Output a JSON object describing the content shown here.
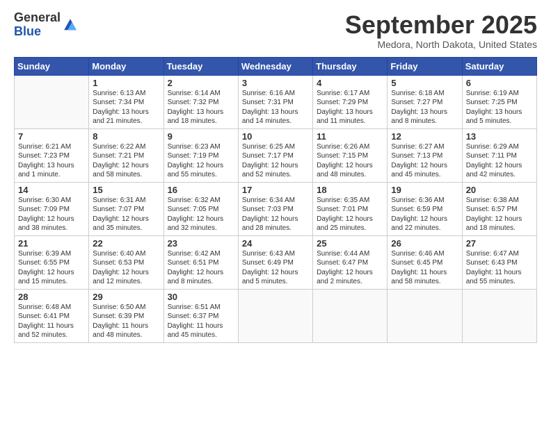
{
  "logo": {
    "general": "General",
    "blue": "Blue"
  },
  "header": {
    "month": "September 2025",
    "location": "Medora, North Dakota, United States"
  },
  "weekdays": [
    "Sunday",
    "Monday",
    "Tuesday",
    "Wednesday",
    "Thursday",
    "Friday",
    "Saturday"
  ],
  "weeks": [
    [
      {
        "day": "",
        "info": ""
      },
      {
        "day": "1",
        "info": "Sunrise: 6:13 AM\nSunset: 7:34 PM\nDaylight: 13 hours\nand 21 minutes."
      },
      {
        "day": "2",
        "info": "Sunrise: 6:14 AM\nSunset: 7:32 PM\nDaylight: 13 hours\nand 18 minutes."
      },
      {
        "day": "3",
        "info": "Sunrise: 6:16 AM\nSunset: 7:31 PM\nDaylight: 13 hours\nand 14 minutes."
      },
      {
        "day": "4",
        "info": "Sunrise: 6:17 AM\nSunset: 7:29 PM\nDaylight: 13 hours\nand 11 minutes."
      },
      {
        "day": "5",
        "info": "Sunrise: 6:18 AM\nSunset: 7:27 PM\nDaylight: 13 hours\nand 8 minutes."
      },
      {
        "day": "6",
        "info": "Sunrise: 6:19 AM\nSunset: 7:25 PM\nDaylight: 13 hours\nand 5 minutes."
      }
    ],
    [
      {
        "day": "7",
        "info": "Sunrise: 6:21 AM\nSunset: 7:23 PM\nDaylight: 13 hours\nand 1 minute."
      },
      {
        "day": "8",
        "info": "Sunrise: 6:22 AM\nSunset: 7:21 PM\nDaylight: 12 hours\nand 58 minutes."
      },
      {
        "day": "9",
        "info": "Sunrise: 6:23 AM\nSunset: 7:19 PM\nDaylight: 12 hours\nand 55 minutes."
      },
      {
        "day": "10",
        "info": "Sunrise: 6:25 AM\nSunset: 7:17 PM\nDaylight: 12 hours\nand 52 minutes."
      },
      {
        "day": "11",
        "info": "Sunrise: 6:26 AM\nSunset: 7:15 PM\nDaylight: 12 hours\nand 48 minutes."
      },
      {
        "day": "12",
        "info": "Sunrise: 6:27 AM\nSunset: 7:13 PM\nDaylight: 12 hours\nand 45 minutes."
      },
      {
        "day": "13",
        "info": "Sunrise: 6:29 AM\nSunset: 7:11 PM\nDaylight: 12 hours\nand 42 minutes."
      }
    ],
    [
      {
        "day": "14",
        "info": "Sunrise: 6:30 AM\nSunset: 7:09 PM\nDaylight: 12 hours\nand 38 minutes."
      },
      {
        "day": "15",
        "info": "Sunrise: 6:31 AM\nSunset: 7:07 PM\nDaylight: 12 hours\nand 35 minutes."
      },
      {
        "day": "16",
        "info": "Sunrise: 6:32 AM\nSunset: 7:05 PM\nDaylight: 12 hours\nand 32 minutes."
      },
      {
        "day": "17",
        "info": "Sunrise: 6:34 AM\nSunset: 7:03 PM\nDaylight: 12 hours\nand 28 minutes."
      },
      {
        "day": "18",
        "info": "Sunrise: 6:35 AM\nSunset: 7:01 PM\nDaylight: 12 hours\nand 25 minutes."
      },
      {
        "day": "19",
        "info": "Sunrise: 6:36 AM\nSunset: 6:59 PM\nDaylight: 12 hours\nand 22 minutes."
      },
      {
        "day": "20",
        "info": "Sunrise: 6:38 AM\nSunset: 6:57 PM\nDaylight: 12 hours\nand 18 minutes."
      }
    ],
    [
      {
        "day": "21",
        "info": "Sunrise: 6:39 AM\nSunset: 6:55 PM\nDaylight: 12 hours\nand 15 minutes."
      },
      {
        "day": "22",
        "info": "Sunrise: 6:40 AM\nSunset: 6:53 PM\nDaylight: 12 hours\nand 12 minutes."
      },
      {
        "day": "23",
        "info": "Sunrise: 6:42 AM\nSunset: 6:51 PM\nDaylight: 12 hours\nand 8 minutes."
      },
      {
        "day": "24",
        "info": "Sunrise: 6:43 AM\nSunset: 6:49 PM\nDaylight: 12 hours\nand 5 minutes."
      },
      {
        "day": "25",
        "info": "Sunrise: 6:44 AM\nSunset: 6:47 PM\nDaylight: 12 hours\nand 2 minutes."
      },
      {
        "day": "26",
        "info": "Sunrise: 6:46 AM\nSunset: 6:45 PM\nDaylight: 11 hours\nand 58 minutes."
      },
      {
        "day": "27",
        "info": "Sunrise: 6:47 AM\nSunset: 6:43 PM\nDaylight: 11 hours\nand 55 minutes."
      }
    ],
    [
      {
        "day": "28",
        "info": "Sunrise: 6:48 AM\nSunset: 6:41 PM\nDaylight: 11 hours\nand 52 minutes."
      },
      {
        "day": "29",
        "info": "Sunrise: 6:50 AM\nSunset: 6:39 PM\nDaylight: 11 hours\nand 48 minutes."
      },
      {
        "day": "30",
        "info": "Sunrise: 6:51 AM\nSunset: 6:37 PM\nDaylight: 11 hours\nand 45 minutes."
      },
      {
        "day": "",
        "info": ""
      },
      {
        "day": "",
        "info": ""
      },
      {
        "day": "",
        "info": ""
      },
      {
        "day": "",
        "info": ""
      }
    ]
  ]
}
